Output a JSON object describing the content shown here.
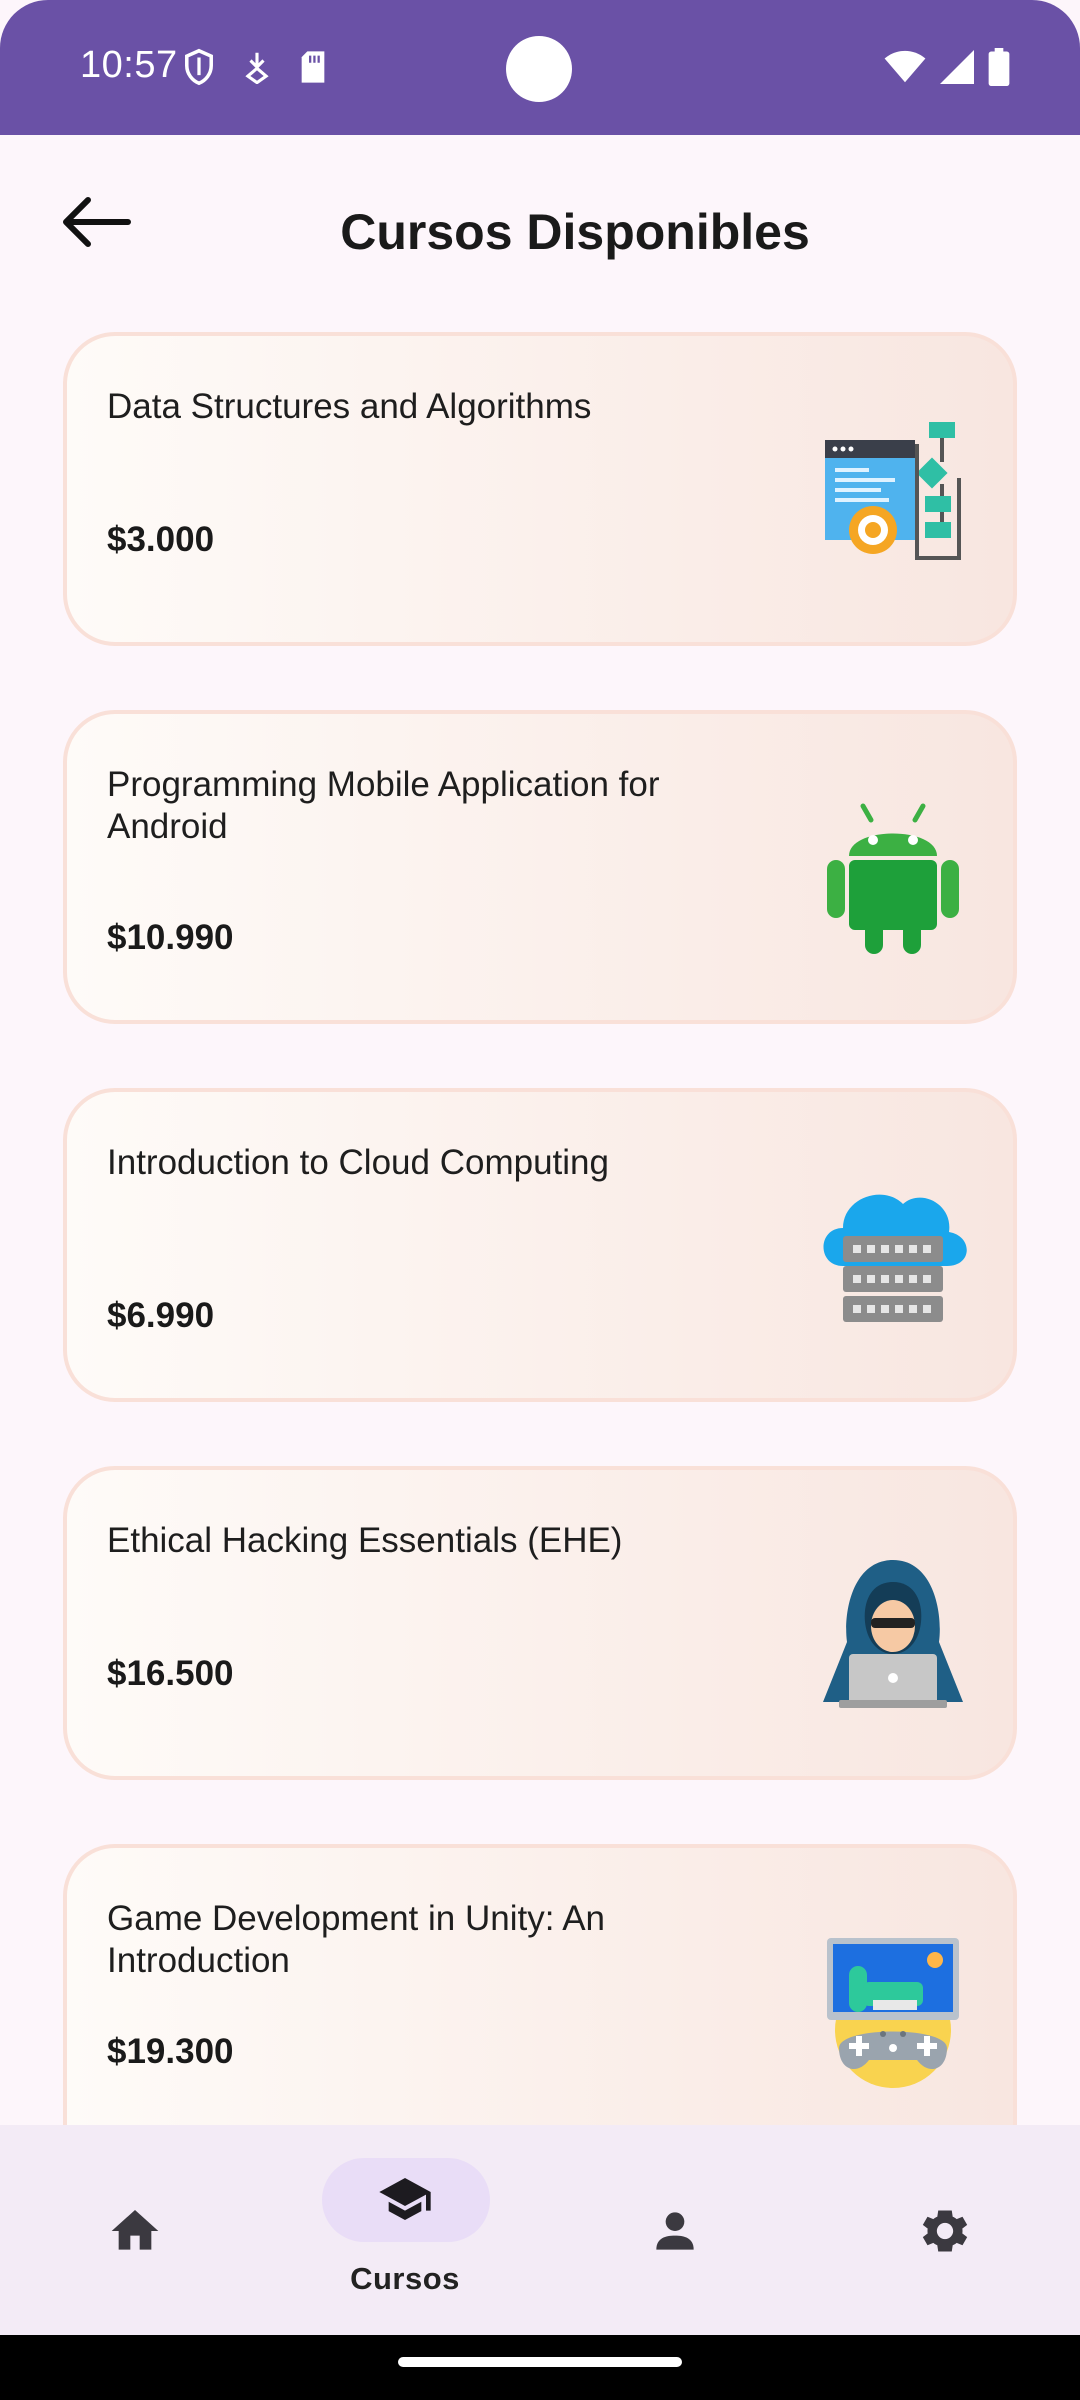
{
  "status_bar": {
    "time": "10:57",
    "left_icons": [
      "shield-icon",
      "location-download-icon",
      "sd-card-icon"
    ],
    "right_icons": [
      "wifi-icon",
      "signal-icon",
      "battery-icon"
    ],
    "background_color": "#6a51a6"
  },
  "header": {
    "title": "Cursos Disponibles",
    "back_icon": "arrow-back-icon"
  },
  "courses": [
    {
      "title": "Data Structures and Algorithms",
      "price": "$3.000",
      "icon": "flowchart-icon"
    },
    {
      "title": "Programming Mobile Application for Android",
      "price": "$10.990",
      "icon": "android-icon"
    },
    {
      "title": "Introduction to Cloud Computing",
      "price": "$6.990",
      "icon": "cloud-server-icon"
    },
    {
      "title": "Ethical Hacking Essentials (EHE)",
      "price": "$16.500",
      "icon": "hacker-icon"
    },
    {
      "title": "Game Development in Unity: An Introduction",
      "price": "$19.300",
      "icon": "game-dev-icon"
    }
  ],
  "bottom_nav": {
    "items": [
      {
        "id": "home",
        "icon": "home-icon",
        "label": ""
      },
      {
        "id": "courses",
        "icon": "graduation-cap-icon",
        "label": "Cursos",
        "active": true
      },
      {
        "id": "profile",
        "icon": "person-icon",
        "label": ""
      },
      {
        "id": "settings",
        "icon": "gear-icon",
        "label": ""
      }
    ],
    "active_color": "#e9ddf7"
  }
}
